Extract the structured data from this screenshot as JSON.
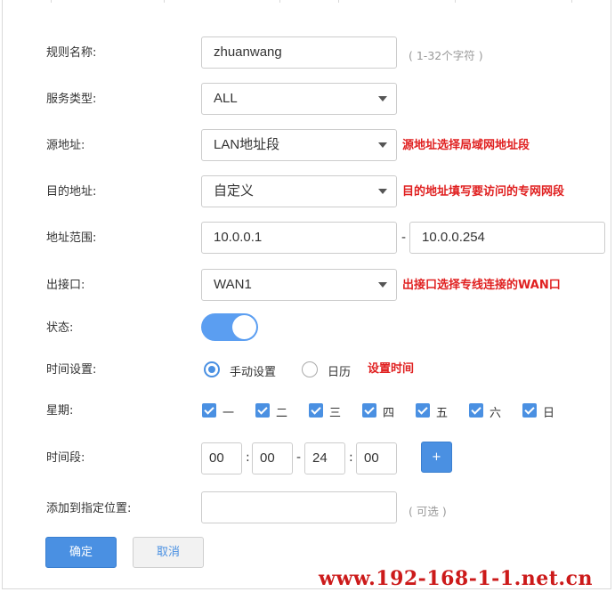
{
  "form": {
    "rule_name": {
      "label": "规则名称:",
      "value": "zhuanwang",
      "hint": "( 1-32个字符 )"
    },
    "service_type": {
      "label": "服务类型:",
      "value": "ALL"
    },
    "source_address": {
      "label": "源地址:",
      "value": "LAN地址段",
      "note": "源地址选择局域网地址段"
    },
    "dest_address": {
      "label": "目的地址:",
      "value": "自定义",
      "note": "目的地址填写要访问的专网网段"
    },
    "address_range": {
      "label": "地址范围:",
      "start": "10.0.0.1",
      "separator": "-",
      "end": "10.0.0.254"
    },
    "outbound": {
      "label": "出接口:",
      "value": "WAN1",
      "note": "出接口选择专线连接的WAN口"
    },
    "status": {
      "label": "状态:",
      "enabled": true
    },
    "time_setting": {
      "label": "时间设置:",
      "options": [
        "手动设置",
        "日历"
      ],
      "selected": "手动设置",
      "note": "设置时间"
    },
    "weekdays": {
      "label": "星期:",
      "days": [
        "一",
        "二",
        "三",
        "四",
        "五",
        "六",
        "日"
      ],
      "checked": [
        true,
        true,
        true,
        true,
        true,
        true,
        true
      ]
    },
    "time_period": {
      "label": "时间段:",
      "start_hour": "00",
      "start_minute": "00",
      "end_hour": "24",
      "end_minute": "00",
      "colon": ":",
      "dash": "-",
      "add_label": "+"
    },
    "position": {
      "label": "添加到指定位置:",
      "value": "",
      "hint": "( 可选 )"
    }
  },
  "buttons": {
    "confirm": "确定",
    "cancel": "取消"
  },
  "watermark": "www.192-168-1-1.net.cn",
  "colors": {
    "accent": "#4a90e2",
    "note_red": "#e02020",
    "toggle_on": "#5b9ef1"
  }
}
